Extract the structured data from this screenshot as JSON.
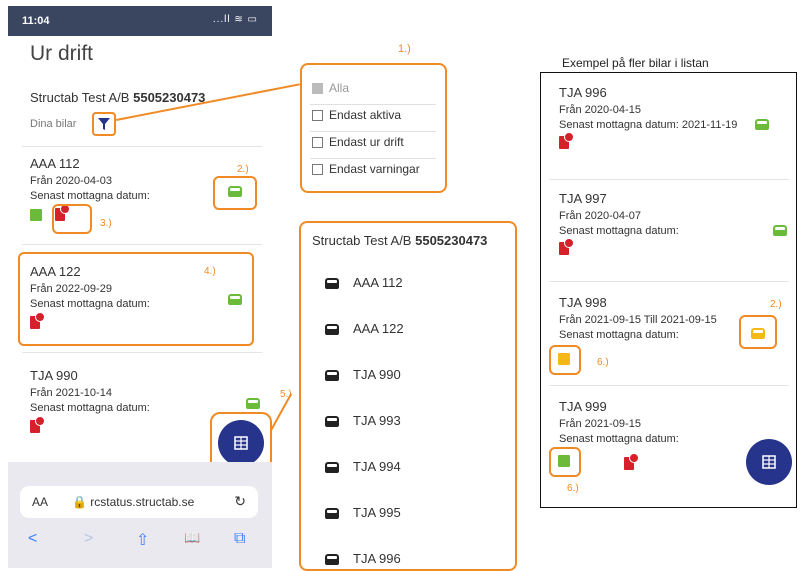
{
  "phone": {
    "time": "11:04",
    "signal": "...ll ≋ ▭",
    "page_title": "Ur drift",
    "company_name": "Structab Test A/B",
    "company_number": "5505230473",
    "dina_bilar": "Dina bilar",
    "cars": [
      {
        "plate": "AAA 112",
        "from": "Från 2020-04-03",
        "received": "Senast mottagna datum:"
      },
      {
        "plate": "AAA 122",
        "from": "Från 2022-09-29",
        "received": "Senast mottagna datum:"
      },
      {
        "plate": "TJA 990",
        "from": "Från 2021-10-14",
        "received": "Senast mottagna datum:"
      }
    ],
    "browser": {
      "aa": "AA",
      "url": "🔒 rcstatus.structab.se",
      "reload": "↻"
    },
    "nav": {
      "back": "<",
      "forward": ">",
      "share": "⇧",
      "bookmarks": "📖",
      "tabs": "⧉"
    },
    "fab_icon": "building-icon"
  },
  "annotations": {
    "l1": "1.)",
    "l2": "2.)",
    "l3": "3.)",
    "l4": "4.)",
    "l5": "5.)",
    "l2b": "2.)",
    "l6a": "6.)",
    "l6b": "6.)"
  },
  "filter_menu": {
    "options": [
      {
        "label": "Alla",
        "checked": true
      },
      {
        "label": "Endast aktiva",
        "checked": false
      },
      {
        "label": "Endast ur drift",
        "checked": false
      },
      {
        "label": "Endast varningar",
        "checked": false
      }
    ]
  },
  "car_list": {
    "company_name": "Structab Test A/B",
    "company_number": "5505230473",
    "plates": [
      "AAA 112",
      "AAA 122",
      "TJA 990",
      "TJA 993",
      "TJA 994",
      "TJA 995",
      "TJA 996"
    ]
  },
  "example_panel": {
    "title": "Exempel på fler bilar i listan",
    "cars": [
      {
        "plate": "TJA 996",
        "from": "Från 2020-04-15",
        "received": "Senast mottagna datum: 2021-11-19"
      },
      {
        "plate": "TJA 997",
        "from": "Från 2020-04-07",
        "received": "Senast mottagna datum:"
      },
      {
        "plate": "TJA 998",
        "from": "Från 2021-09-15 Till 2021-09-15",
        "received": "Senast mottagna datum:"
      },
      {
        "plate": "TJA 999",
        "from": "Från 2021-09-15",
        "received": "Senast mottagna datum:"
      }
    ]
  },
  "colors": {
    "accent": "#f08a24",
    "fab": "#27348b",
    "green": "#6cba3a",
    "yellow": "#f5b917",
    "red": "#d6202a"
  }
}
